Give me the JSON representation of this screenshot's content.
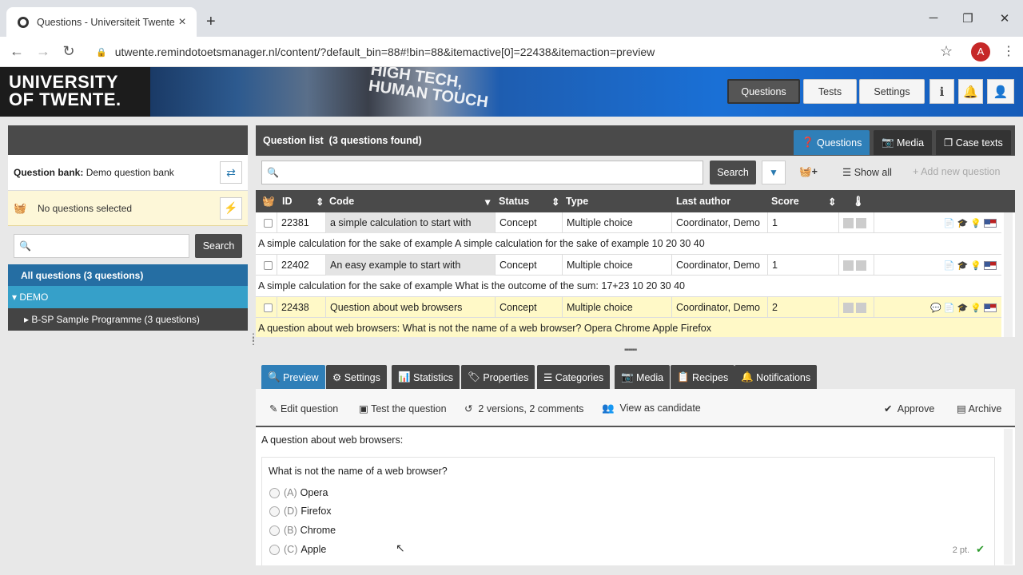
{
  "browser": {
    "tab_title": "Questions - Universiteit Twente",
    "url": "utwente.remindotoetsmanager.nl/content/?default_bin=88#!bin=88&itemactive[0]=22438&itemaction=preview",
    "profile_initial": "A"
  },
  "header": {
    "logo_line1": "UNIVERSITY",
    "logo_line2": "OF TWENTE.",
    "slogan_line1": "HIGH TECH,",
    "slogan_line2": "HUMAN TOUCH",
    "nav": [
      "Questions",
      "Tests",
      "Settings"
    ]
  },
  "sidebar": {
    "bank_label": "Question bank:",
    "bank_name": "Demo question bank",
    "no_selection": "No questions selected",
    "search_placeholder": "",
    "search_button": "Search",
    "tree": [
      {
        "label": "All questions (3 questions)"
      },
      {
        "label": "DEMO"
      },
      {
        "label": "B-SP Sample Programme (3 questions)"
      }
    ]
  },
  "question_list": {
    "title": "Question list",
    "count_text": "(3 questions found)",
    "tabs": [
      "Questions",
      "Media",
      "Case texts"
    ],
    "search_button": "Search",
    "show_all": "Show all",
    "add_new": "Add new question",
    "columns": [
      "ID",
      "Code",
      "Status",
      "Type",
      "Last author",
      "Score"
    ],
    "rows": [
      {
        "id": "22381",
        "code": "a simple calculation to start with",
        "status": "Concept",
        "type": "Multiple choice",
        "author": "Coordinator, Demo",
        "score": "1",
        "description": "A simple calculation for the sake of example A simple calculation for the sake of example 10 20 30 40"
      },
      {
        "id": "22402",
        "code": "An easy example to start with",
        "status": "Concept",
        "type": "Multiple choice",
        "author": "Coordinator, Demo",
        "score": "1",
        "description": "A simple calculation for the sake of example What is the outcome of the sum: 17+23 10 20 30 40"
      },
      {
        "id": "22438",
        "code": "Question about web browsers",
        "status": "Concept",
        "type": "Multiple choice",
        "author": "Coordinator, Demo",
        "score": "2",
        "description": "A question about web browsers: What is not the name of a web browser? Opera Chrome Apple Firefox"
      }
    ]
  },
  "preview_tabs": [
    "Preview",
    "Settings",
    "Statistics",
    "Properties",
    "Categories",
    "Media",
    "Recipes",
    "Notifications"
  ],
  "preview_actions": {
    "edit": "Edit question",
    "test": "Test the question",
    "versions": "2 versions, 2 comments",
    "view": "View as candidate",
    "approve": "Approve",
    "archive": "Archive"
  },
  "preview": {
    "intro": "A question about web browsers:",
    "question": "What is not the name of a web browser?",
    "options": [
      {
        "letter": "(A)",
        "text": "Opera"
      },
      {
        "letter": "(D)",
        "text": "Firefox"
      },
      {
        "letter": "(B)",
        "text": "Chrome"
      },
      {
        "letter": "(C)",
        "text": "Apple"
      }
    ],
    "points": "2 pt."
  },
  "colors": {
    "accent": "#2f7fb8",
    "dark": "#4a4a4a",
    "highlight": "#fff9c7"
  }
}
